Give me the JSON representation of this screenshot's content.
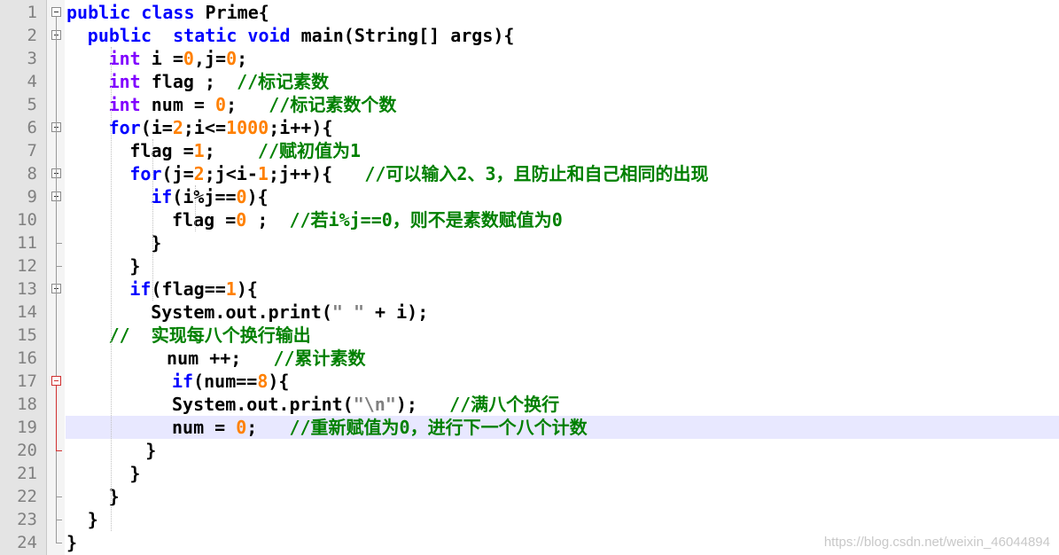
{
  "editor": {
    "lines": [
      {
        "n": "1",
        "indent": 0,
        "tokens": [
          [
            "kw",
            "public class "
          ],
          [
            "tx",
            "Prime{"
          ]
        ]
      },
      {
        "n": "2",
        "indent": 2,
        "tokens": [
          [
            "kw",
            "public  static void "
          ],
          [
            "tx",
            "main(String[] args){"
          ]
        ]
      },
      {
        "n": "3",
        "indent": 4,
        "tokens": [
          [
            "ty",
            "int "
          ],
          [
            "tx",
            "i ="
          ],
          [
            "num",
            "0"
          ],
          [
            "tx",
            ",j="
          ],
          [
            "num",
            "0"
          ],
          [
            "tx",
            ";"
          ]
        ]
      },
      {
        "n": "4",
        "indent": 4,
        "tokens": [
          [
            "ty",
            "int "
          ],
          [
            "tx",
            "flag ;  "
          ],
          [
            "cm",
            "//标记素数"
          ]
        ]
      },
      {
        "n": "5",
        "indent": 4,
        "tokens": [
          [
            "ty",
            "int "
          ],
          [
            "tx",
            "num = "
          ],
          [
            "num",
            "0"
          ],
          [
            "tx",
            ";   "
          ],
          [
            "cm",
            "//标记素数个数"
          ]
        ]
      },
      {
        "n": "6",
        "indent": 4,
        "tokens": [
          [
            "kw",
            "for"
          ],
          [
            "tx",
            "(i="
          ],
          [
            "num",
            "2"
          ],
          [
            "tx",
            ";i<="
          ],
          [
            "num",
            "1000"
          ],
          [
            "tx",
            ";i++){"
          ]
        ]
      },
      {
        "n": "7",
        "indent": 6,
        "tokens": [
          [
            "tx",
            "flag ="
          ],
          [
            "num",
            "1"
          ],
          [
            "tx",
            ";    "
          ],
          [
            "cm",
            "//赋初值为1"
          ]
        ]
      },
      {
        "n": "8",
        "indent": 6,
        "tokens": [
          [
            "kw",
            "for"
          ],
          [
            "tx",
            "(j="
          ],
          [
            "num",
            "2"
          ],
          [
            "tx",
            ";j<i-"
          ],
          [
            "num",
            "1"
          ],
          [
            "tx",
            ";j++){   "
          ],
          [
            "cm",
            "//可以输入2、3，且防止和自己相同的出现"
          ]
        ]
      },
      {
        "n": "9",
        "indent": 8,
        "tokens": [
          [
            "kw",
            "if"
          ],
          [
            "tx",
            "(i%j=="
          ],
          [
            "num",
            "0"
          ],
          [
            "tx",
            "){"
          ]
        ]
      },
      {
        "n": "10",
        "indent": 10,
        "tokens": [
          [
            "tx",
            "flag ="
          ],
          [
            "num",
            "0"
          ],
          [
            "tx",
            " ;  "
          ],
          [
            "cm",
            "//若i%j==0，则不是素数赋值为0"
          ]
        ]
      },
      {
        "n": "11",
        "indent": 8,
        "tokens": [
          [
            "tx",
            "}"
          ]
        ]
      },
      {
        "n": "12",
        "indent": 6,
        "tokens": [
          [
            "tx",
            "}"
          ]
        ]
      },
      {
        "n": "13",
        "indent": 6,
        "tokens": [
          [
            "kw",
            "if"
          ],
          [
            "tx",
            "(flag=="
          ],
          [
            "num",
            "1"
          ],
          [
            "tx",
            "){"
          ]
        ]
      },
      {
        "n": "14",
        "indent": 8,
        "tokens": [
          [
            "tx",
            "System.out.print("
          ],
          [
            "st",
            "\" \""
          ],
          [
            "tx",
            " + i);"
          ]
        ]
      },
      {
        "n": "15",
        "indent": 4,
        "tokens": [
          [
            "cm",
            "//  实现每八个换行输出"
          ]
        ]
      },
      {
        "n": "16",
        "indent": 9.5,
        "tokens": [
          [
            "tx",
            "num ++;   "
          ],
          [
            "cm",
            "//累计素数"
          ]
        ]
      },
      {
        "n": "17",
        "indent": 10,
        "tokens": [
          [
            "kw",
            "if"
          ],
          [
            "tx",
            "(num=="
          ],
          [
            "num",
            "8"
          ],
          [
            "tx",
            "){"
          ]
        ]
      },
      {
        "n": "18",
        "indent": 10,
        "tokens": [
          [
            "tx",
            "System.out.print("
          ],
          [
            "st",
            "\"\\n\""
          ],
          [
            "tx",
            ");   "
          ],
          [
            "cm",
            "//满八个换行"
          ]
        ]
      },
      {
        "n": "19",
        "indent": 10,
        "tokens": [
          [
            "tx",
            "num = "
          ],
          [
            "num",
            "0"
          ],
          [
            "tx",
            ";   "
          ],
          [
            "cm",
            "//重新赋值为0，进行下一个八个计数"
          ]
        ]
      },
      {
        "n": "20",
        "indent": 7.5,
        "tokens": [
          [
            "tx",
            "}"
          ]
        ]
      },
      {
        "n": "21",
        "indent": 6,
        "tokens": [
          [
            "tx",
            "}"
          ]
        ]
      },
      {
        "n": "22",
        "indent": 4,
        "tokens": [
          [
            "tx",
            "}"
          ]
        ]
      },
      {
        "n": "23",
        "indent": 2,
        "tokens": [
          [
            "tx",
            "}"
          ]
        ]
      },
      {
        "n": "24",
        "indent": 0,
        "tokens": [
          [
            "tx",
            "}"
          ]
        ]
      }
    ]
  },
  "colors": {
    "keyword": "#0000ff",
    "type": "#8000ff",
    "number": "#ff8000",
    "comment": "#008000",
    "string": "#808080",
    "current_line": "#e8e8ff"
  },
  "watermark": "https://blog.csdn.net/weixin_46044894"
}
